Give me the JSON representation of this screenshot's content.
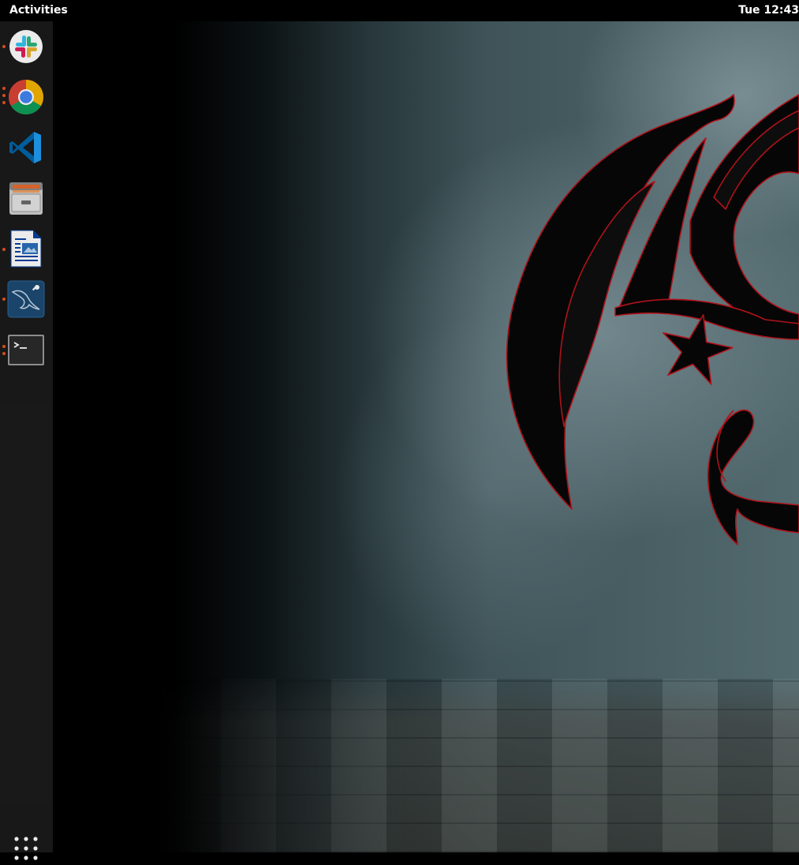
{
  "topbar": {
    "activities_label": "Activities",
    "clock_text": "Tue 12:43"
  },
  "dock": {
    "items": [
      {
        "name": "Slack",
        "icon": "slack-icon",
        "running": true,
        "windows": 1
      },
      {
        "name": "Google Chrome",
        "icon": "chrome-icon",
        "running": true,
        "windows": 3
      },
      {
        "name": "Visual Studio Code",
        "icon": "vscode-icon",
        "running": false,
        "windows": 0
      },
      {
        "name": "Files",
        "icon": "file-cabinet-icon",
        "running": false,
        "windows": 0
      },
      {
        "name": "LibreOffice Writer",
        "icon": "writer-document-icon",
        "running": true,
        "windows": 1
      },
      {
        "name": "MySQL Workbench",
        "icon": "mysql-dolphin-icon",
        "running": true,
        "windows": 1
      },
      {
        "name": "Terminal",
        "icon": "terminal-icon",
        "running": true,
        "windows": 2
      }
    ],
    "show_apps_icon": "grid-icon"
  },
  "colors": {
    "topbar_bg": "#000000",
    "dock_bg": "#1b1b1b",
    "running_indicator": "#e95420",
    "emblem_fill": "#060606",
    "emblem_outline": "#b0121a"
  },
  "wallpaper": {
    "icon": "dragon-emblem-icon"
  }
}
